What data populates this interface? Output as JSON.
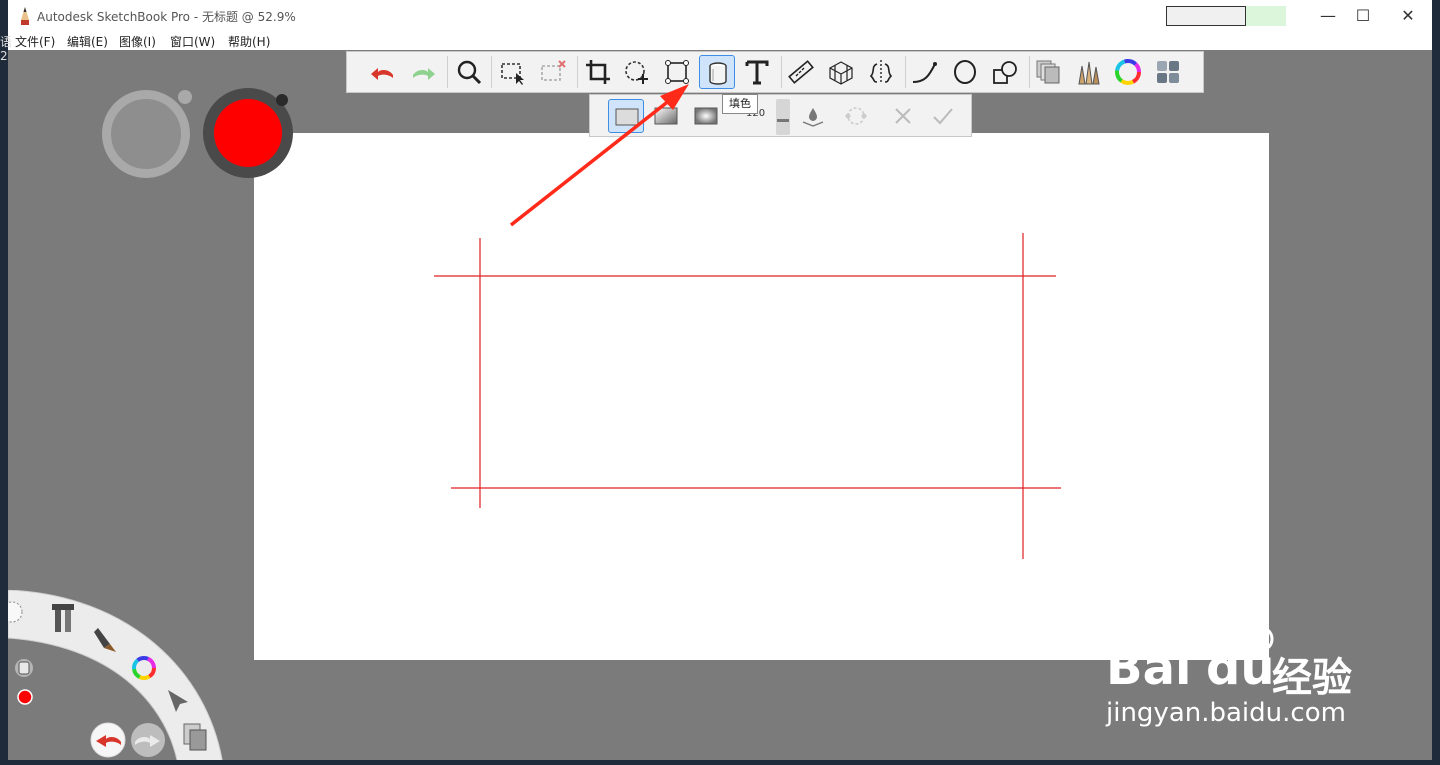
{
  "window": {
    "title": "Autodesk SketchBook Pro - 无标题 @ 52.9%",
    "controls": {
      "minimize": "—",
      "maximize": "☐",
      "close": "✕"
    }
  },
  "desktop_edge": {
    "char1": "语",
    "char2": "2"
  },
  "menu": {
    "items": [
      {
        "label": "文件(F)"
      },
      {
        "label": "编辑(E)"
      },
      {
        "label": "图像(I)"
      },
      {
        "label": "窗口(W)"
      },
      {
        "label": "帮助(H)"
      }
    ]
  },
  "toolbar": {
    "tools": [
      {
        "name": "undo-icon"
      },
      {
        "name": "redo-icon"
      },
      {
        "name": "zoom-icon"
      },
      {
        "name": "select-icon"
      },
      {
        "name": "deselect-icon"
      },
      {
        "name": "crop-icon"
      },
      {
        "name": "lasso-move-icon"
      },
      {
        "name": "transform-icon"
      },
      {
        "name": "fill-bucket-icon"
      },
      {
        "name": "text-icon"
      },
      {
        "name": "ruler-icon"
      },
      {
        "name": "perspective-icon"
      },
      {
        "name": "symmetry-icon"
      },
      {
        "name": "curve-icon"
      },
      {
        "name": "ellipse-icon"
      },
      {
        "name": "shapes-icon"
      },
      {
        "name": "layers-icon"
      },
      {
        "name": "brushes-icon"
      },
      {
        "name": "color-wheel-icon"
      },
      {
        "name": "palette-icon"
      }
    ],
    "active_tool": "fill-bucket-icon"
  },
  "fill_options": {
    "tooltip": "填色",
    "tolerance_value": "120"
  },
  "colors": {
    "brush_color": "#ff0000",
    "canvas": "#ffffff",
    "workspace": "#7b7b7b",
    "accent": "#3f8ee5"
  },
  "watermark": {
    "brand_left": "Bai",
    "brand_right": "du",
    "brand_cn": "经验",
    "url": "jingyan.baidu.com"
  }
}
